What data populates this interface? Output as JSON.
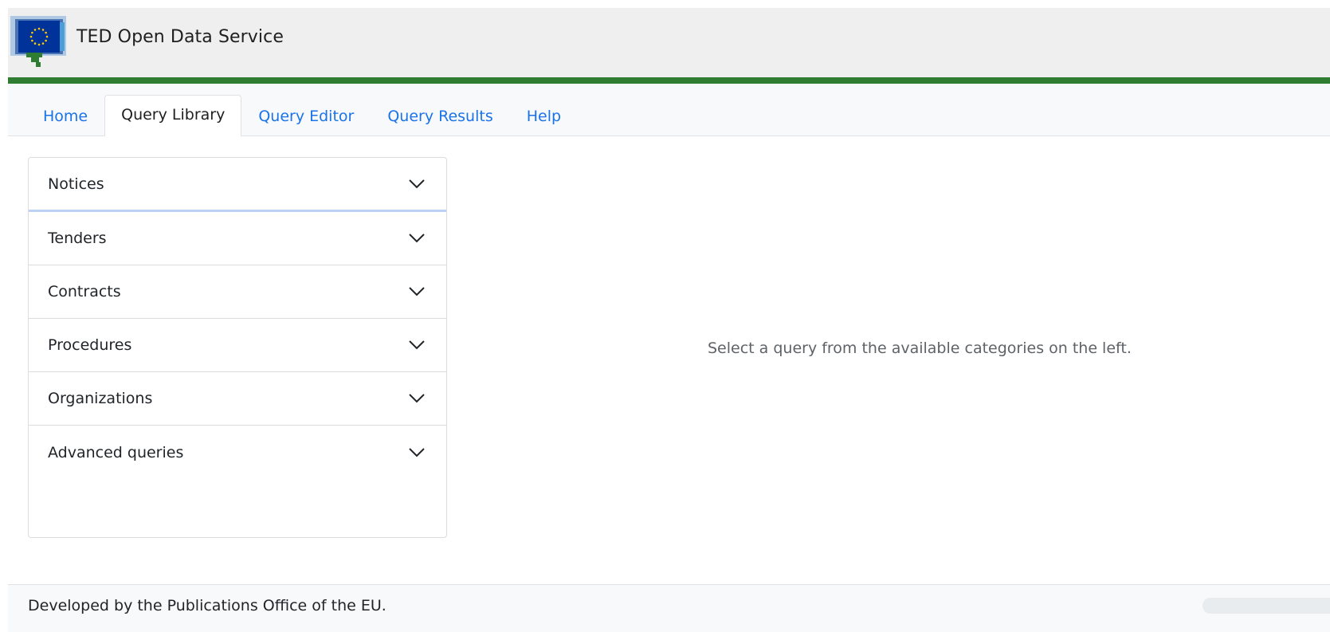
{
  "app": {
    "title": "TED Open Data Service",
    "brand_green": "#2e7d32",
    "logo_icon": "eu-flag-speech-bubble-icon"
  },
  "nav": {
    "tabs": [
      {
        "label": "Home",
        "active": false
      },
      {
        "label": "Query Library",
        "active": true
      },
      {
        "label": "Query Editor",
        "active": false
      },
      {
        "label": "Query Results",
        "active": false
      },
      {
        "label": "Help",
        "active": false
      }
    ],
    "link_color": "#1a73e8"
  },
  "library": {
    "categories": [
      {
        "label": "Notices",
        "expanded": false
      },
      {
        "label": "Tenders",
        "expanded": false
      },
      {
        "label": "Contracts",
        "expanded": false
      },
      {
        "label": "Procedures",
        "expanded": false
      },
      {
        "label": "Organizations",
        "expanded": false
      },
      {
        "label": "Advanced queries",
        "expanded": false
      }
    ],
    "chevron_icon": "chevron-down-icon"
  },
  "main": {
    "empty_message": "Select a query from the available categories on the left."
  },
  "footer": {
    "text": "Developed by the Publications Office of the EU."
  }
}
